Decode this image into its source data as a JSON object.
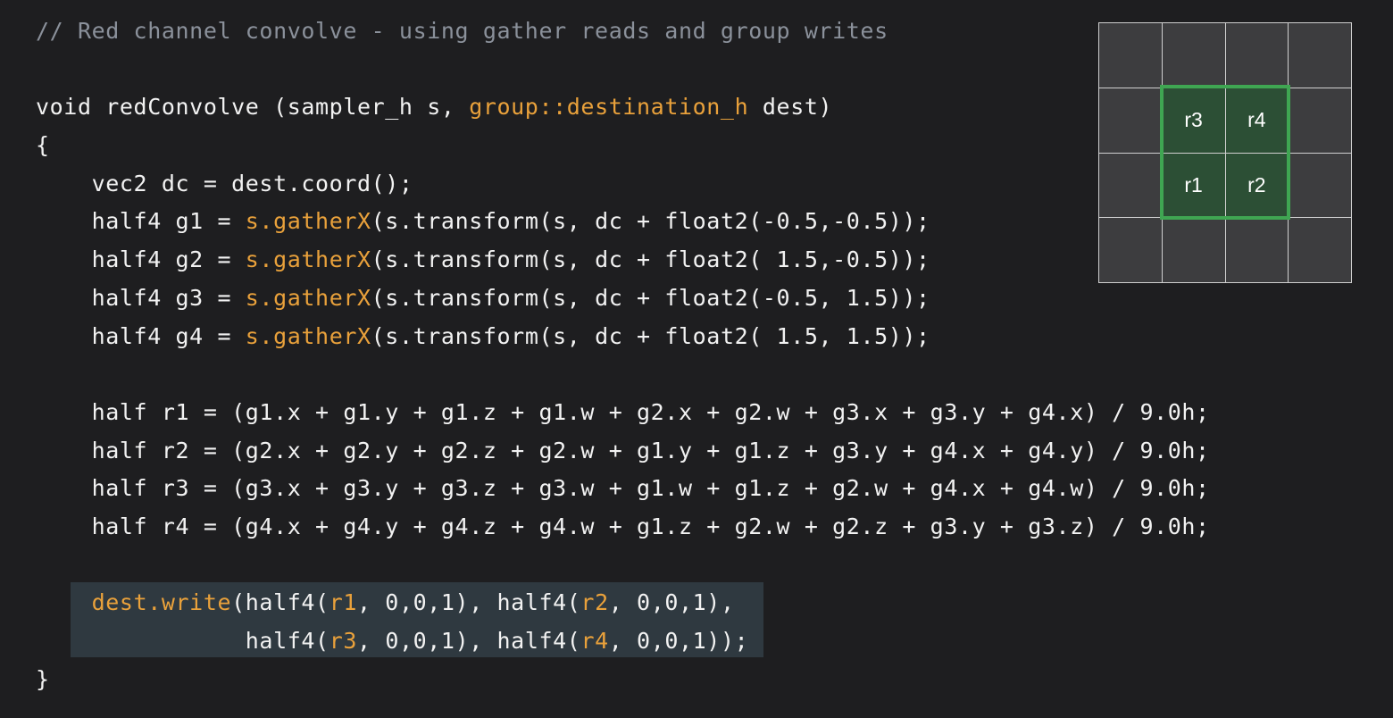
{
  "code": {
    "comment": "// Red channel convolve - using gather reads and group writes",
    "signature_pre": "void redConvolve (sampler_h s, ",
    "signature_hl": "group::destination_h",
    "signature_post": " dest)",
    "open_brace": "{",
    "dc_line": "    vec2 dc = dest.coord();",
    "gather_lines": [
      {
        "pre": "    half4 g1 = ",
        "hl": "s.gatherX",
        "post": "(s.transform(s, dc + float2(-0.5,-0.5));"
      },
      {
        "pre": "    half4 g2 = ",
        "hl": "s.gatherX",
        "post": "(s.transform(s, dc + float2( 1.5,-0.5));"
      },
      {
        "pre": "    half4 g3 = ",
        "hl": "s.gatherX",
        "post": "(s.transform(s, dc + float2(-0.5, 1.5));"
      },
      {
        "pre": "    half4 g4 = ",
        "hl": "s.gatherX",
        "post": "(s.transform(s, dc + float2( 1.5, 1.5));"
      }
    ],
    "r_lines": [
      "    half r1 = (g1.x + g1.y + g1.z + g1.w + g2.x + g2.w + g3.x + g3.y + g4.x) / 9.0h;",
      "    half r2 = (g2.x + g2.y + g2.z + g2.w + g1.y + g1.z + g3.y + g4.x + g4.y) / 9.0h;",
      "    half r3 = (g3.x + g3.y + g3.z + g3.w + g1.w + g1.z + g2.w + g4.x + g4.w) / 9.0h;",
      "    half r4 = (g4.x + g4.y + g4.z + g4.w + g1.z + g2.w + g2.z + g3.y + g3.z) / 9.0h;"
    ],
    "write_line1": {
      "indent": "    ",
      "hl_call": "dest.write",
      "p1": "(half4(",
      "r1": "r1",
      "p2": ", 0,0,1), half4(",
      "r2": "r2",
      "p3": ", 0,0,1),"
    },
    "write_line2": {
      "indent": "               ",
      "p1": "half4(",
      "r3": "r3",
      "p2": ", 0,0,1), half4(",
      "r4": "r4",
      "p3": ", 0,0,1));"
    },
    "close_brace": "}"
  },
  "colors": {
    "background": "#1e1e20",
    "text": "#f2f2f2",
    "comment": "#8b919b",
    "highlight": "#e9a13b",
    "write_bg": "#2f3940",
    "cell": "#3d3d3f",
    "group_cell": "#2c4f35",
    "group_border": "#3fa652"
  },
  "grid": {
    "rows": 4,
    "cols": 4,
    "cells": [
      "",
      "",
      "",
      "",
      "",
      "r3",
      "r4",
      "",
      "",
      "r1",
      "r2",
      "",
      "",
      "",
      "",
      ""
    ],
    "group_cells": [
      5,
      6,
      9,
      10
    ]
  }
}
